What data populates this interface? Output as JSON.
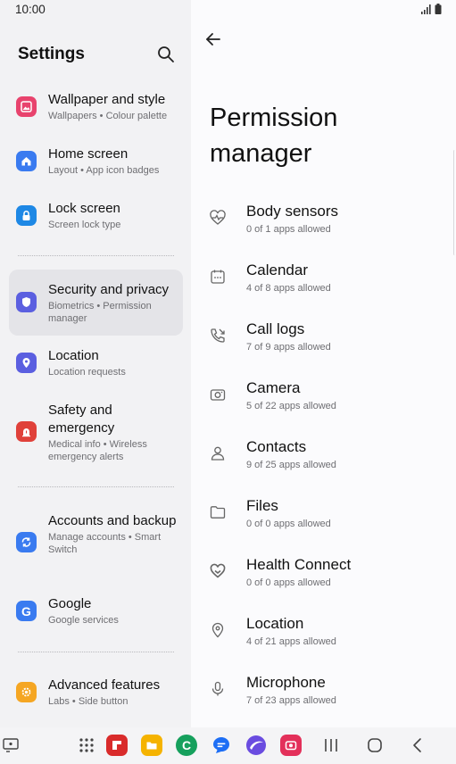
{
  "status": {
    "time": "10:00"
  },
  "left": {
    "title": "Settings",
    "items": [
      {
        "label": "Wallpaper and style",
        "sub": "Wallpapers  •  Colour palette",
        "icon": "wallpaper-icon",
        "color": "#e8436d"
      },
      {
        "label": "Home screen",
        "sub": "Layout  •  App icon badges",
        "icon": "home-icon",
        "color": "#3a7bf0"
      },
      {
        "label": "Lock screen",
        "sub": "Screen lock type",
        "icon": "lock-icon",
        "color": "#1e88e5"
      },
      {
        "label": "Security and privacy",
        "sub": "Biometrics  •  Permission manager",
        "icon": "shield-icon",
        "color": "#5b5fe0"
      },
      {
        "label": "Location",
        "sub": "Location requests",
        "icon": "location-pin-icon",
        "color": "#5b5fe0"
      },
      {
        "label": "Safety and emergency",
        "sub": "Medical info  •  Wireless emergency alerts",
        "icon": "emergency-icon",
        "color": "#e0413a"
      },
      {
        "label": "Accounts and backup",
        "sub": "Manage accounts  •  Smart Switch",
        "icon": "sync-icon",
        "color": "#3a7bf0"
      },
      {
        "label": "Google",
        "sub": "Google services",
        "icon": "google-icon",
        "color": "#3a7bf0"
      },
      {
        "label": "Advanced features",
        "sub": "Labs  •  Side button",
        "icon": "gear-plus-icon",
        "color": "#f5a623"
      }
    ]
  },
  "right": {
    "title": "Permission manager",
    "items": [
      {
        "label": "Body sensors",
        "sub": "0 of 1 apps allowed",
        "icon": "heartbeat-icon"
      },
      {
        "label": "Calendar",
        "sub": "4 of 8 apps allowed",
        "icon": "calendar-icon"
      },
      {
        "label": "Call logs",
        "sub": "7 of 9 apps allowed",
        "icon": "call-log-icon"
      },
      {
        "label": "Camera",
        "sub": "5 of 22 apps allowed",
        "icon": "camera-icon"
      },
      {
        "label": "Contacts",
        "sub": "9 of 25 apps allowed",
        "icon": "contact-icon"
      },
      {
        "label": "Files",
        "sub": "0 of 0 apps allowed",
        "icon": "folder-icon"
      },
      {
        "label": "Health Connect",
        "sub": "0 of 0 apps allowed",
        "icon": "health-connect-icon"
      },
      {
        "label": "Location",
        "sub": "4 of 21 apps allowed",
        "icon": "location-pin-icon"
      },
      {
        "label": "Microphone",
        "sub": "7 of 23 apps allowed",
        "icon": "microphone-icon"
      }
    ]
  },
  "dock": {
    "apps": [
      {
        "icon": "app-drawer-icon"
      },
      {
        "icon": "flipboard-app-icon",
        "color": "#d92b2b"
      },
      {
        "icon": "my-files-app-icon",
        "color": "#f5b301"
      },
      {
        "icon": "phone-app-icon",
        "color": "#16a05d"
      },
      {
        "icon": "messages-app-icon",
        "color": "#1d6ef5"
      },
      {
        "icon": "internet-app-icon",
        "color": "#6a4ce0"
      },
      {
        "icon": "camera-app-icon",
        "color": "#e3305a"
      }
    ]
  }
}
